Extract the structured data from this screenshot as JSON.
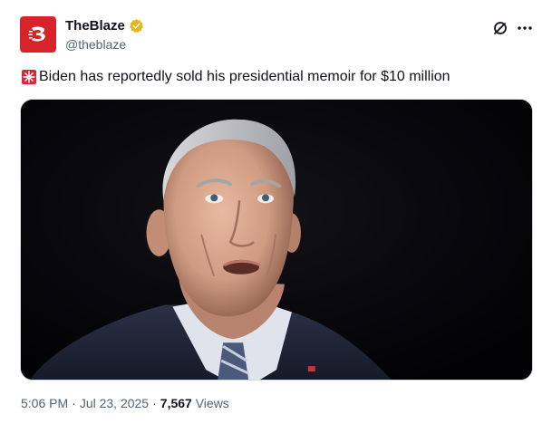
{
  "author": {
    "display_name": "TheBlaze",
    "handle": "@theblaze",
    "avatar_icon": "theblaze-logo",
    "verified_icon": "gold-verified-badge"
  },
  "header_actions": {
    "grok_icon": "grok-icon",
    "more_icon": "more-options-icon"
  },
  "tweet": {
    "emoji_icon": "police-siren-emoji",
    "text": "Biden has reportedly sold his presidential memoir for $10 million"
  },
  "media": {
    "type": "photo"
  },
  "meta": {
    "time": "5:06 PM",
    "separator1": "·",
    "date": "Jul 23, 2025",
    "separator2": "·",
    "views_count": "7,567",
    "views_label": "Views"
  },
  "colors": {
    "brand": "#d8232a",
    "verified": "#e2b719",
    "muted_text": "#536471"
  }
}
